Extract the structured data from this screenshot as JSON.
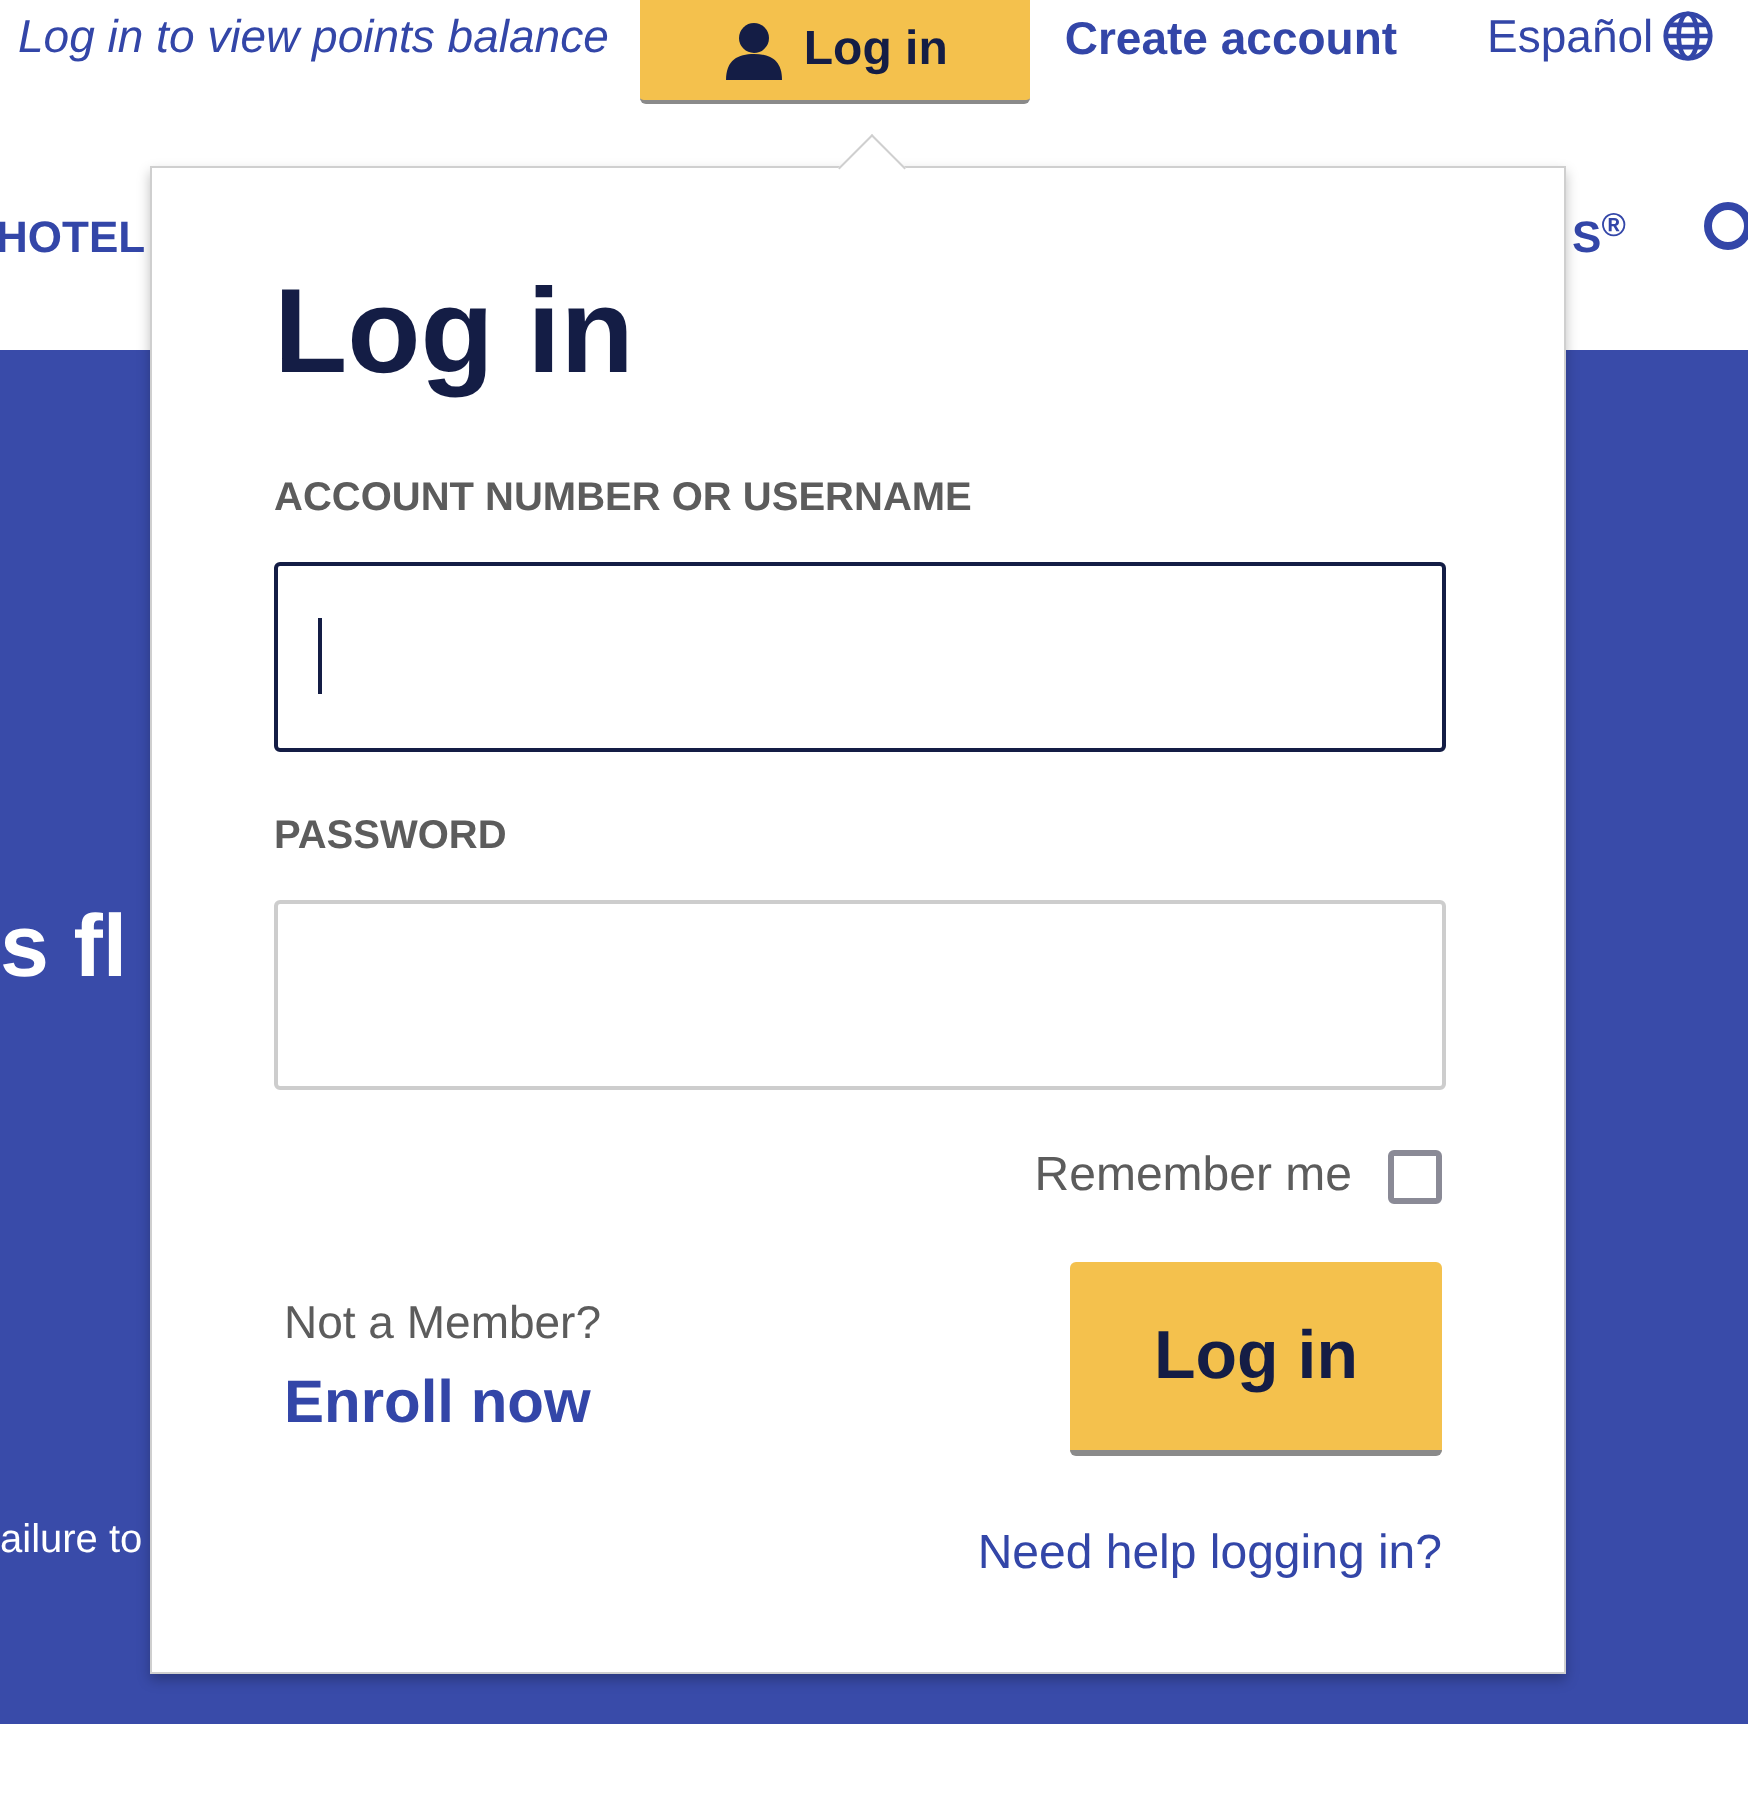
{
  "header": {
    "points_link": "Log in to view points balance",
    "login_button": {
      "label": "Log in",
      "expanded": true
    },
    "create_account": "Create account",
    "language": "Español"
  },
  "nav": {
    "items": [
      "HOTEL",
      "S$^{®}$"
    ]
  },
  "hero": {
    "headline": "s fl",
    "note": "ailure to"
  },
  "login_popover": {
    "title": "Log in",
    "fields": [
      {
        "label": "ACCOUNT NUMBER OR USERNAME",
        "focused": true
      },
      {
        "label": "PASSWORD",
        "focused": false
      }
    ],
    "remember": {
      "label": "Remember me",
      "checked": false
    },
    "member_prompt": "Not a Member?",
    "enroll_link": "Enroll now",
    "submit": "Log in",
    "help_link": "Need help logging in?"
  }
}
